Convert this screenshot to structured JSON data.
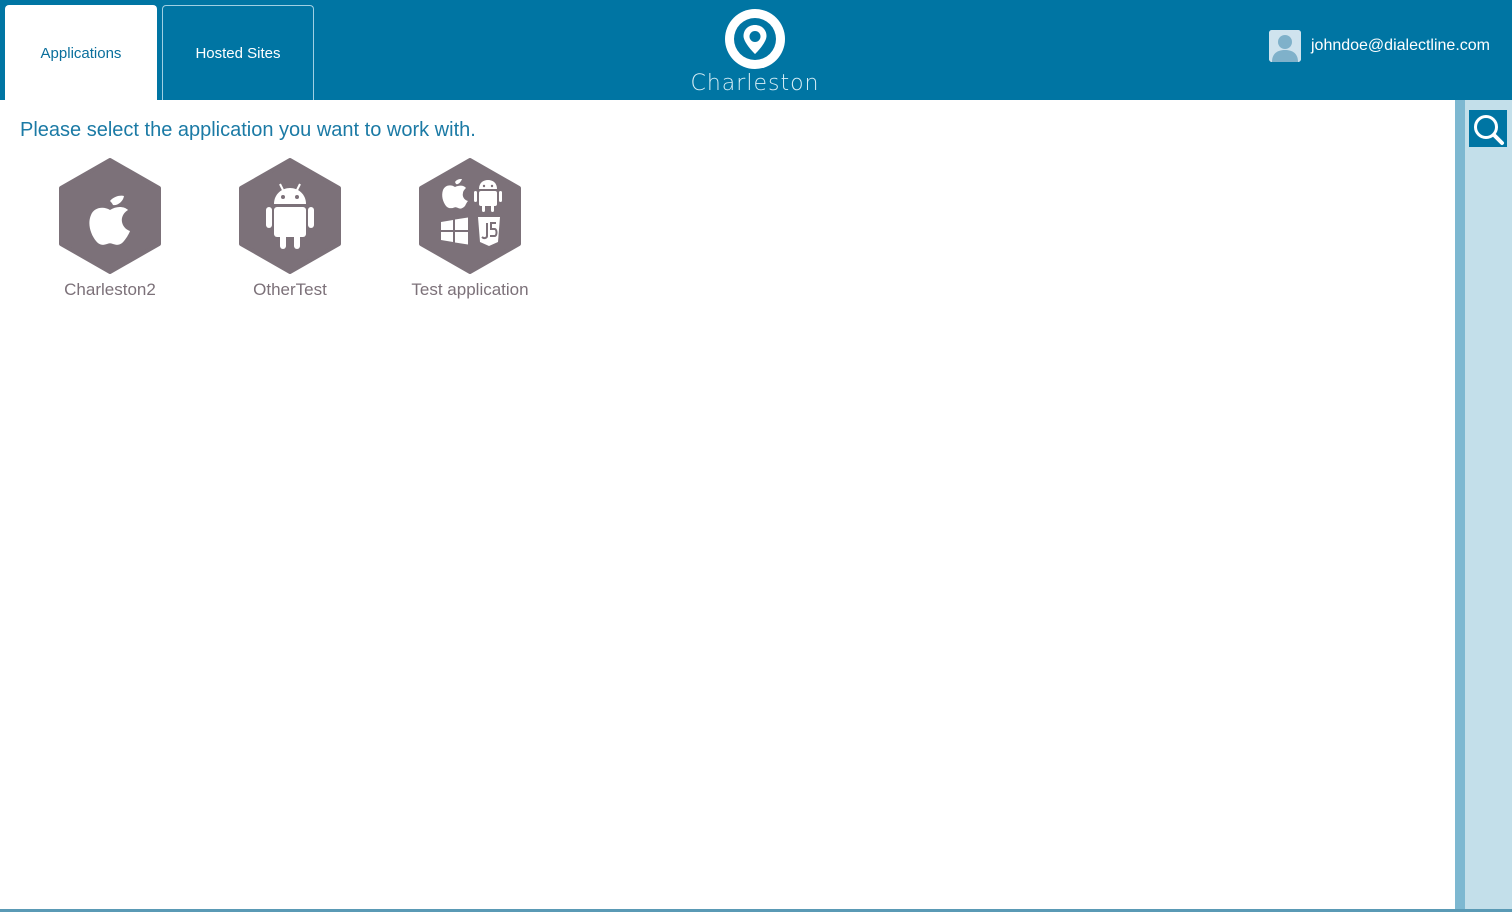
{
  "header": {
    "tabs": [
      {
        "label": "Applications",
        "active": true
      },
      {
        "label": "Hosted Sites",
        "active": false
      }
    ],
    "logo_text": "Charleston",
    "user_email": "johndoe@dialectline.com"
  },
  "main": {
    "prompt": "Please select the application you want to work with.",
    "apps": [
      {
        "label": "Charleston2",
        "icon": "apple-icon"
      },
      {
        "label": "OtherTest",
        "icon": "android-icon"
      },
      {
        "label": "Test application",
        "icon": "multi-platform-icon"
      }
    ]
  },
  "colors": {
    "header": "#0075a3",
    "hexagon": "#7c7179",
    "prompt": "#1b7aa5",
    "sidebar": "#c3dfea"
  }
}
